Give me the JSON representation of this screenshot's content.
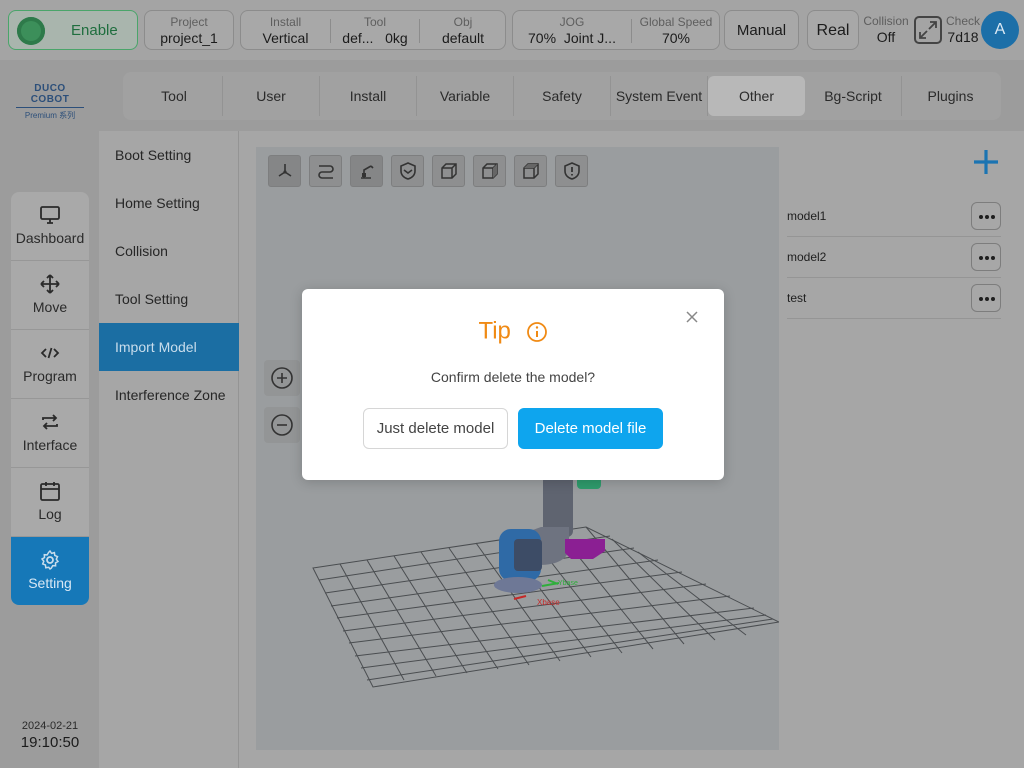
{
  "status_bar": {
    "enable_label": "Enable",
    "project": {
      "label": "Project",
      "value": "project_1"
    },
    "install": {
      "label": "Install",
      "value": "Vertical"
    },
    "tool": {
      "label": "Tool",
      "name": "def...",
      "payload": "0kg"
    },
    "obj": {
      "label": "Obj",
      "value": "default"
    },
    "jog": {
      "label": "JOG",
      "value": "70%",
      "mode": "Joint J..."
    },
    "global_speed": {
      "label": "Global Speed",
      "value": "70%"
    },
    "manual_label": "Manual",
    "real_label": "Real",
    "collision": {
      "label": "Collision",
      "value": "Off"
    },
    "check": {
      "label": "Check",
      "value": "7d18"
    },
    "avatar_initial": "A"
  },
  "logo": {
    "brand": "DUCO COBOT",
    "series": "Premium 系列"
  },
  "left_nav": {
    "items": [
      {
        "label": "Dashboard",
        "icon": "monitor-icon"
      },
      {
        "label": "Move",
        "icon": "move-arrows-icon"
      },
      {
        "label": "Program",
        "icon": "code-icon"
      },
      {
        "label": "Interface",
        "icon": "swap-icon"
      },
      {
        "label": "Log",
        "icon": "calendar-icon"
      },
      {
        "label": "Setting",
        "icon": "gear-icon",
        "active": true
      }
    ]
  },
  "datetime": {
    "date": "2024-02-21",
    "time": "19:10:50"
  },
  "tabs": [
    {
      "label": "Tool"
    },
    {
      "label": "User"
    },
    {
      "label": "Install"
    },
    {
      "label": "Variable"
    },
    {
      "label": "Safety"
    },
    {
      "label": "System Event"
    },
    {
      "label": "Other",
      "active": true
    },
    {
      "label": "Bg-Script"
    },
    {
      "label": "Plugins"
    }
  ],
  "submenu": [
    {
      "label": "Boot Setting"
    },
    {
      "label": "Home Setting"
    },
    {
      "label": "Collision"
    },
    {
      "label": "Tool Setting"
    },
    {
      "label": "Import Model",
      "active": true
    },
    {
      "label": "Interference Zone"
    }
  ],
  "viewport": {
    "toolbar": [
      "axes-icon",
      "path-icon",
      "robot-arm-icon",
      "shield-check-icon",
      "cube-front-icon",
      "cube-right-icon",
      "cube-left-icon",
      "shield-alert-icon"
    ],
    "axis_labels": {
      "x": "Xbase",
      "y": "Ybase"
    }
  },
  "models": [
    {
      "name": "model1"
    },
    {
      "name": "model2"
    },
    {
      "name": "test"
    }
  ],
  "dialog": {
    "title": "Tip",
    "message": "Confirm delete the model?",
    "secondary_button": "Just delete model",
    "primary_button": "Delete model file"
  },
  "colors": {
    "accent_blue": "#0ea5ee",
    "active_nav": "#1678b8",
    "tip_orange": "#f08a14",
    "enable_green": "#3c8f5a"
  }
}
